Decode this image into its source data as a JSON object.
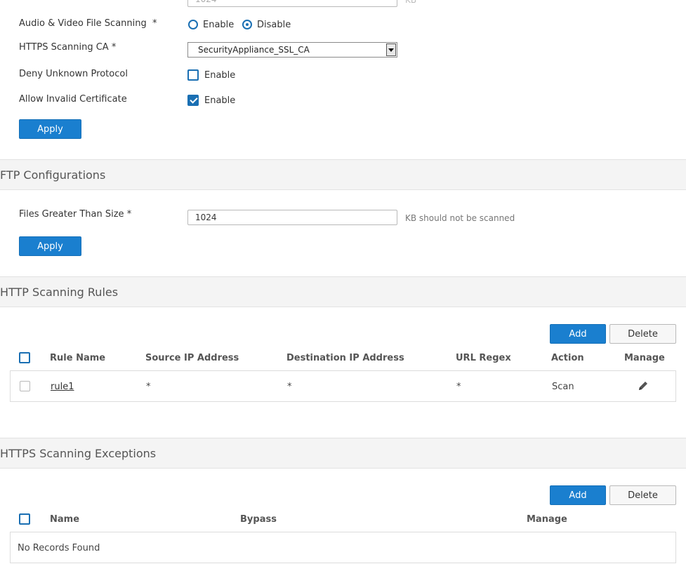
{
  "top_partial": {
    "value": "1024",
    "unit": "KB"
  },
  "http_config": {
    "audio_video_label": "Audio & Video File Scanning",
    "required_mark": "*",
    "audio_video_options": {
      "enable": "Enable",
      "disable": "Disable",
      "selected": "Disable"
    },
    "https_ca_label": "HTTPS Scanning CA",
    "https_ca_value": "SecurityAppliance_SSL_CA",
    "deny_unknown_label": "Deny Unknown Protocol",
    "deny_unknown_option": "Enable",
    "deny_unknown_checked": false,
    "allow_invalid_label": "Allow Invalid Certificate",
    "allow_invalid_option": "Enable",
    "allow_invalid_checked": true,
    "apply_label": "Apply"
  },
  "ftp_config": {
    "title": "FTP Configurations",
    "files_size_label": "Files Greater Than Size",
    "required_mark": "*",
    "files_size_value": "1024",
    "files_size_hint": "KB should not be scanned",
    "apply_label": "Apply"
  },
  "http_rules": {
    "title": "HTTP Scanning Rules",
    "add_label": "Add",
    "delete_label": "Delete",
    "columns": {
      "rule_name": "Rule Name",
      "source_ip": "Source IP Address",
      "destination_ip": "Destination IP Address",
      "url_regex": "URL Regex",
      "action": "Action",
      "manage": "Manage"
    },
    "rows": [
      {
        "rule_name": "rule1",
        "source_ip": "*",
        "destination_ip": "*",
        "url_regex": "*",
        "action": "Scan"
      }
    ]
  },
  "https_exceptions": {
    "title": "HTTPS Scanning Exceptions",
    "add_label": "Add",
    "delete_label": "Delete",
    "columns": {
      "name": "Name",
      "bypass": "Bypass",
      "manage": "Manage"
    },
    "empty_text": "No Records Found"
  },
  "colors": {
    "primary": "#1a7fcf",
    "accent": "#1a6fb3",
    "section_bg": "#f4f4f4"
  }
}
